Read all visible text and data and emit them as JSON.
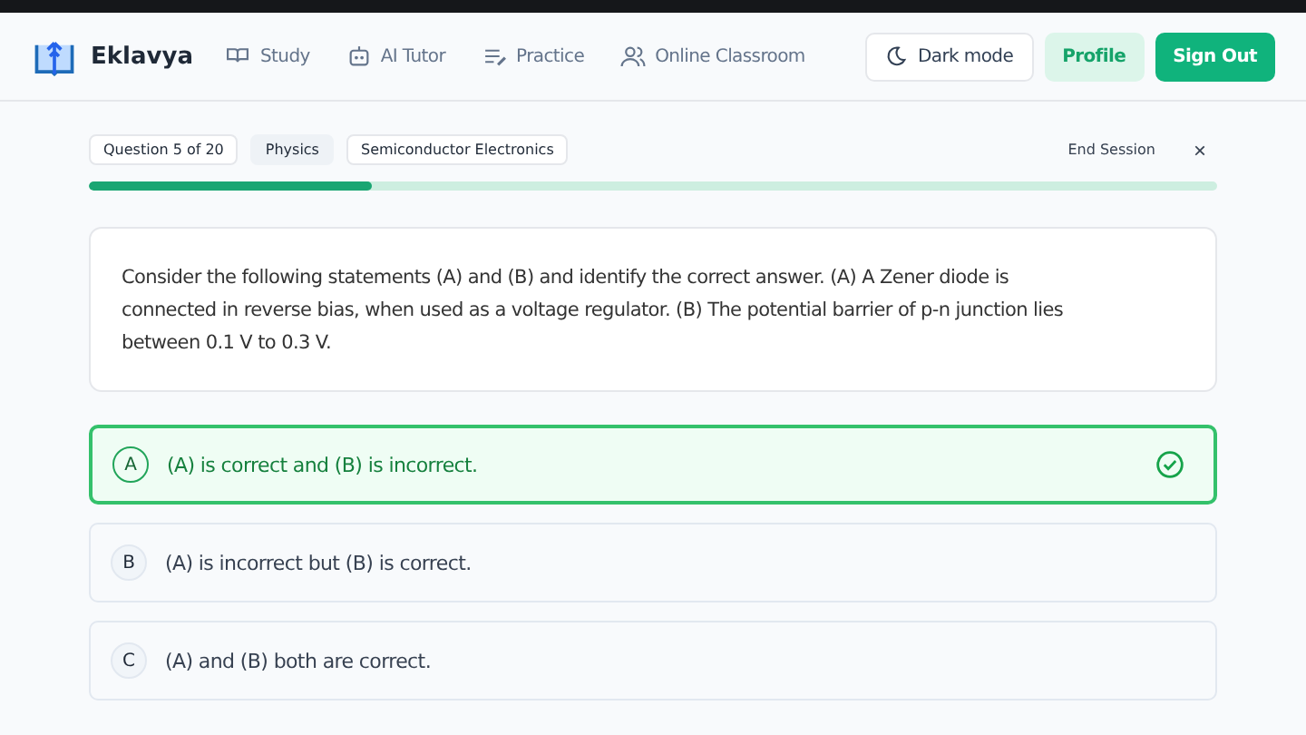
{
  "nav": {
    "brand": "Eklavya",
    "links": [
      {
        "label": "Study"
      },
      {
        "label": "AI Tutor"
      },
      {
        "label": "Practice"
      },
      {
        "label": "Online Classroom"
      }
    ],
    "dark_mode": "Dark mode",
    "profile": "Profile",
    "sign_out": "Sign Out"
  },
  "session": {
    "tags": [
      {
        "label": "Question 5 of 20",
        "kind": "outline"
      },
      {
        "label": "Physics",
        "kind": "filled"
      },
      {
        "label": "Semiconductor Electronics",
        "kind": "outline"
      }
    ],
    "end": "End Session",
    "close": "×",
    "progress": {
      "level": 0.25
    }
  },
  "question": "Consider the following statements (A) and (B) and identify the correct answer. (A) A Zener diode is connected in reverse bias, when used as a voltage regulator. (B) The potential barrier of p-n junction lies between 0.1 V to 0.3 V.",
  "options": [
    {
      "letter": "A",
      "text": "(A) is correct and (B) is incorrect.",
      "selected": true
    },
    {
      "letter": "B",
      "text": "(A) is incorrect but (B) is correct.",
      "selected": false
    },
    {
      "letter": "C",
      "text": "(A) and (B) both are correct.",
      "selected": false
    }
  ]
}
